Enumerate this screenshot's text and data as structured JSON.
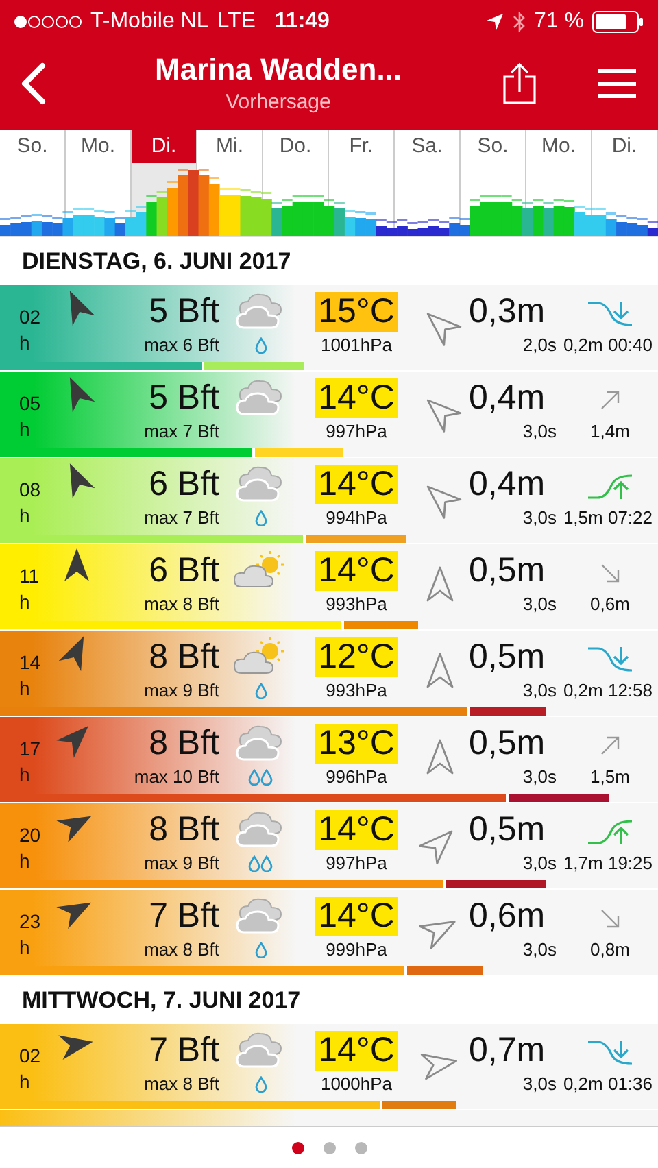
{
  "status_bar": {
    "carrier": "T-Mobile NL",
    "network": "LTE",
    "time": "11:49",
    "battery": "71 %"
  },
  "header": {
    "title": "Marina Wadden...",
    "subtitle": "Vorhersage"
  },
  "days": [
    {
      "label": "So.",
      "selected": false
    },
    {
      "label": "Mo.",
      "selected": false
    },
    {
      "label": "Di.",
      "selected": true
    },
    {
      "label": "Mi.",
      "selected": false
    },
    {
      "label": "Do.",
      "selected": false
    },
    {
      "label": "Fr.",
      "selected": false
    },
    {
      "label": "Sa.",
      "selected": false
    },
    {
      "label": "So.",
      "selected": false
    },
    {
      "label": "Mo.",
      "selected": false
    },
    {
      "label": "Di.",
      "selected": false
    }
  ],
  "sections": [
    {
      "heading": "DIENSTAG, 6. JUNI 2017",
      "rows": [
        {
          "hour": "02",
          "unit": "h",
          "wind_arrow": {
            "kind": "nnw"
          },
          "wind": "5 Bft",
          "gust": "max 6 Bft",
          "weather": {
            "kind": "cloud"
          },
          "rain": {
            "kind": "one-drop"
          },
          "temp": {
            "text": "15°C",
            "color": "#ffc20e"
          },
          "pressure": "1001hPa",
          "wave_arrow": {
            "kind": "nw"
          },
          "wave": "0,3m",
          "period": "2,0s",
          "tide": {
            "kind": "low",
            "text": "0,2m 00:40"
          },
          "color": "#2bb693",
          "wind_bar": {
            "level": 0.306,
            "color": "#2bb693"
          },
          "gust_bar": {
            "level": 0.463,
            "color": "#a8ec5c"
          }
        },
        {
          "hour": "05",
          "unit": "h",
          "wind_arrow": {
            "kind": "nnw"
          },
          "wind": "5 Bft",
          "gust": "max 7 Bft",
          "weather": {
            "kind": "cloud"
          },
          "temp": {
            "text": "14°C",
            "color": "#ffe600"
          },
          "pressure": "997hPa",
          "wave_arrow": {
            "kind": "nw"
          },
          "wave": "0,4m",
          "period": "3,0s",
          "tide": {
            "kind": "rising",
            "text": "1,4m"
          },
          "color": "#00cc33",
          "wind_bar": {
            "level": 0.383,
            "color": "#00cc33"
          },
          "gust_bar": {
            "level": 0.52,
            "color": "#ffd422"
          }
        },
        {
          "hour": "08",
          "unit": "h",
          "wind_arrow": {
            "kind": "nnw"
          },
          "wind": "6 Bft",
          "gust": "max 7 Bft",
          "weather": {
            "kind": "cloud"
          },
          "rain": {
            "kind": "one-drop"
          },
          "temp": {
            "text": "14°C",
            "color": "#ffe600"
          },
          "pressure": "994hPa",
          "wave_arrow": {
            "kind": "nw"
          },
          "wave": "0,4m",
          "period": "3,0s",
          "tide": {
            "kind": "high",
            "text": "1,5m 07:22"
          },
          "color": "#aaee55",
          "wind_bar": {
            "level": 0.46,
            "color": "#aaee55"
          },
          "gust_bar": {
            "level": 0.617,
            "color": "#f0a020"
          }
        },
        {
          "hour": "11",
          "unit": "h",
          "wind_arrow": {
            "kind": "n"
          },
          "wind": "6 Bft",
          "gust": "max 8 Bft",
          "weather": {
            "kind": "sun-cloud"
          },
          "temp": {
            "text": "14°C",
            "color": "#ffe600"
          },
          "pressure": "993hPa",
          "wave_arrow": {
            "kind": "n"
          },
          "wave": "0,5m",
          "period": "3,0s",
          "tide": {
            "kind": "falling",
            "text": "0,6m"
          },
          "color": "#ffee00",
          "wind_bar": {
            "level": 0.519,
            "color": "#ffee00"
          },
          "gust_bar": {
            "level": 0.635,
            "color": "#ee8800"
          }
        },
        {
          "hour": "14",
          "unit": "h",
          "wind_arrow": {
            "kind": "nne"
          },
          "wind": "8 Bft",
          "gust": "max 9 Bft",
          "weather": {
            "kind": "sun-cloud"
          },
          "rain": {
            "kind": "one-drop"
          },
          "temp": {
            "text": "12°C",
            "color": "#ffe600"
          },
          "pressure": "993hPa",
          "wave_arrow": {
            "kind": "n"
          },
          "wave": "0,5m",
          "period": "3,0s",
          "tide": {
            "kind": "low",
            "text": "0,2m 12:58"
          },
          "color": "#e8830e",
          "wind_bar": {
            "level": 0.71,
            "color": "#e8800e"
          },
          "gust_bar": {
            "level": 0.83,
            "color": "#b81c24"
          }
        },
        {
          "hour": "17",
          "unit": "h",
          "wind_arrow": {
            "kind": "ne"
          },
          "wind": "8 Bft",
          "gust": "max 10 Bft",
          "weather": {
            "kind": "cloud"
          },
          "rain": {
            "kind": "two-drops"
          },
          "temp": {
            "text": "13°C",
            "color": "#ffe600"
          },
          "pressure": "996hPa",
          "wave_arrow": {
            "kind": "n"
          },
          "wave": "0,5m",
          "period": "3,0s",
          "tide": {
            "kind": "rising",
            "text": "1,5m"
          },
          "color": "#dd4a1c",
          "wind_bar": {
            "level": 0.769,
            "color": "#dd4a1c"
          },
          "gust_bar": {
            "level": 0.925,
            "color": "#aa1030"
          }
        },
        {
          "hour": "20",
          "unit": "h",
          "wind_arrow": {
            "kind": "ene"
          },
          "wind": "8 Bft",
          "gust": "max 9 Bft",
          "weather": {
            "kind": "cloud"
          },
          "rain": {
            "kind": "two-drops"
          },
          "temp": {
            "text": "14°C",
            "color": "#ffe600"
          },
          "pressure": "997hPa",
          "wave_arrow": {
            "kind": "ne"
          },
          "wave": "0,5m",
          "period": "3,0s",
          "tide": {
            "kind": "high",
            "text": "1,7m 19:25"
          },
          "color": "#f7900a",
          "wind_bar": {
            "level": 0.673,
            "color": "#f7900a"
          },
          "gust_bar": {
            "level": 0.83,
            "color": "#b01828"
          }
        },
        {
          "hour": "23",
          "unit": "h",
          "wind_arrow": {
            "kind": "ene"
          },
          "wind": "7 Bft",
          "gust": "max 8 Bft",
          "weather": {
            "kind": "cloud"
          },
          "rain": {
            "kind": "one-drop"
          },
          "temp": {
            "text": "14°C",
            "color": "#ffe600"
          },
          "pressure": "999hPa",
          "wave_arrow": {
            "kind": "ene"
          },
          "wave": "0,6m",
          "period": "3,0s",
          "tide": {
            "kind": "falling",
            "text": "0,8m"
          },
          "color": "#f9a010",
          "wind_bar": {
            "level": 0.615,
            "color": "#f9a010"
          },
          "gust_bar": {
            "level": 0.733,
            "color": "#e06810"
          }
        }
      ]
    },
    {
      "heading": "MITTWOCH, 7. JUNI 2017",
      "rows": [
        {
          "hour": "02",
          "unit": "h",
          "wind_arrow": {
            "kind": "e"
          },
          "wind": "7 Bft",
          "gust": "max 8 Bft",
          "weather": {
            "kind": "cloud"
          },
          "rain": {
            "kind": "one-drop"
          },
          "temp": {
            "text": "14°C",
            "color": "#ffe600"
          },
          "pressure": "1000hPa",
          "wave_arrow": {
            "kind": "e"
          },
          "wave": "0,7m",
          "period": "3,0s",
          "tide": {
            "kind": "low",
            "text": "0,2m 01:36"
          },
          "color": "#fbbf14",
          "wind_bar": {
            "level": 0.577,
            "color": "#fbbf14"
          },
          "gust_bar": {
            "level": 0.694,
            "color": "#e07c10"
          }
        }
      ]
    }
  ],
  "pages": [
    {
      "selected": true
    },
    {
      "selected": false
    },
    {
      "selected": false
    }
  ]
}
